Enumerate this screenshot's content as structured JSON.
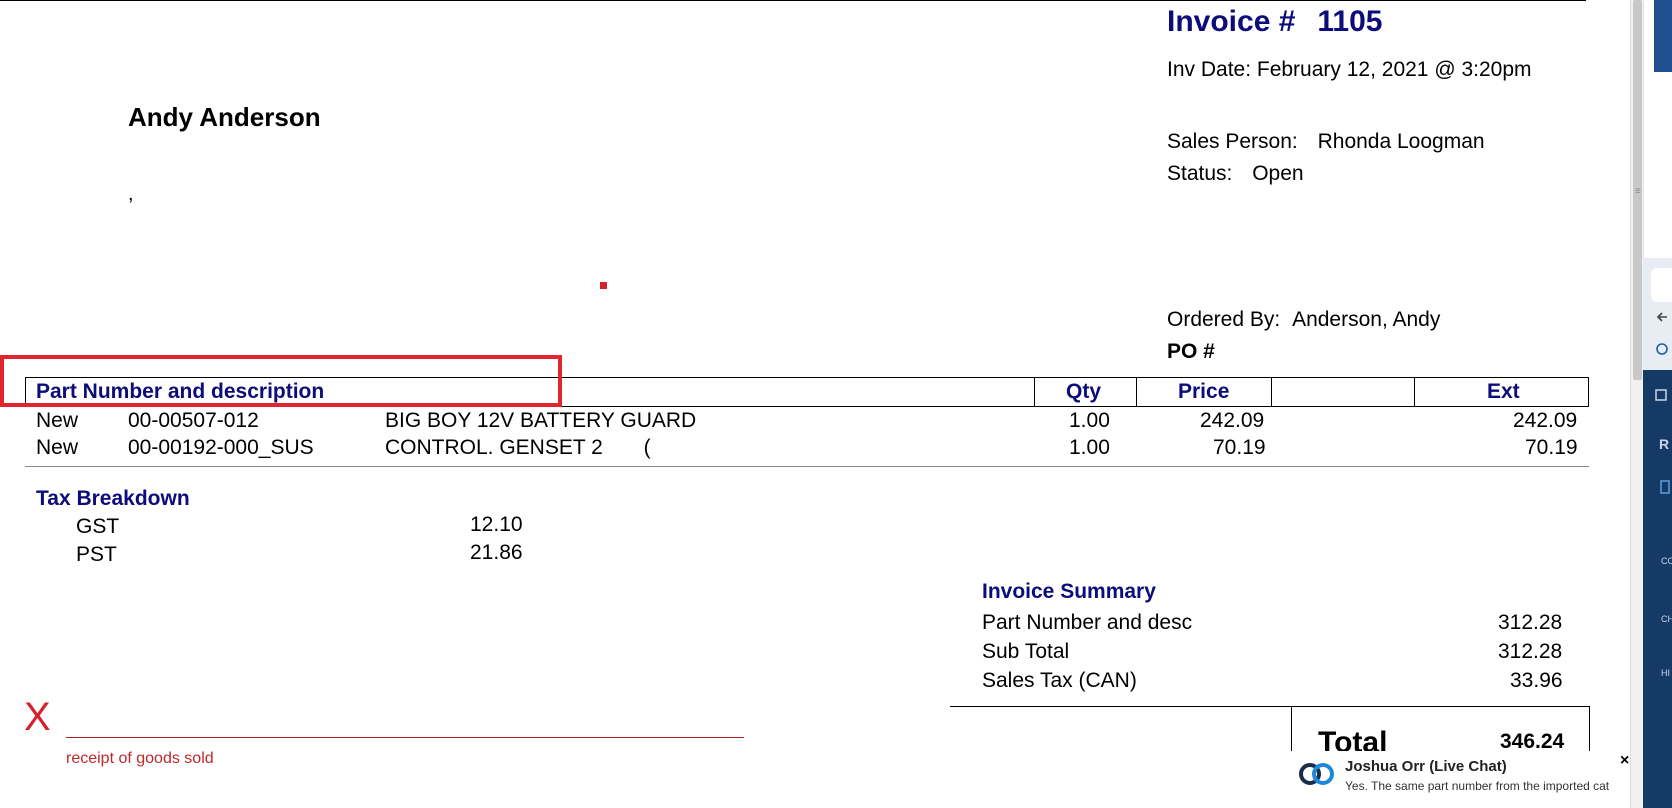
{
  "invoice": {
    "title_label": "Invoice #",
    "number": "1105",
    "date_line": "Inv Date: February 12, 2021 @  3:20pm",
    "sales_person_label": "Sales Person:",
    "sales_person": "Rhonda Loogman",
    "status_label": "Status:",
    "status": "Open",
    "ordered_by_label": "Ordered By:",
    "ordered_by": "Anderson, Andy",
    "po_label": "PO #"
  },
  "customer": {
    "name": "Andy Anderson",
    "address_line": ","
  },
  "table": {
    "headers": {
      "part": "Part Number and description",
      "qty": "Qty",
      "price": "Price",
      "ext": "Ext"
    },
    "rows": [
      {
        "condition": "New",
        "part_no": "00-00507-012",
        "description": "BIG BOY 12V BATTERY GUARD",
        "qty": "1.00",
        "price": "242.09",
        "ext": "242.09"
      },
      {
        "condition": "New",
        "part_no": "00-00192-000_SUS",
        "description": "CONTROL. GENSET 2       (",
        "qty": "1.00",
        "price": "70.19",
        "ext": "70.19"
      }
    ]
  },
  "tax_breakdown": {
    "title": "Tax Breakdown",
    "items": [
      {
        "label": "GST",
        "value": "12.10"
      },
      {
        "label": "PST",
        "value": "21.86"
      }
    ]
  },
  "summary": {
    "title": "Invoice Summary",
    "lines": [
      {
        "label": "Part Number and desc",
        "value": "312.28"
      },
      {
        "label": "Sub Total",
        "value": "312.28"
      },
      {
        "label": "Sales Tax (CAN)",
        "value": "33.96"
      }
    ],
    "total_label": "Total",
    "total_value": "346.24"
  },
  "signature": {
    "mark": "X",
    "caption": "receipt of goods sold"
  },
  "chat": {
    "agent_name": "Joshua Orr (Live Chat)",
    "message": "Yes.  The same part number from the imported cat",
    "close_glyph": "×"
  },
  "colors": {
    "heading_blue": "#0c0c7a",
    "highlight_red": "#e02430",
    "signature_red": "#d8202c",
    "side_panel_dark": "#163a66"
  }
}
